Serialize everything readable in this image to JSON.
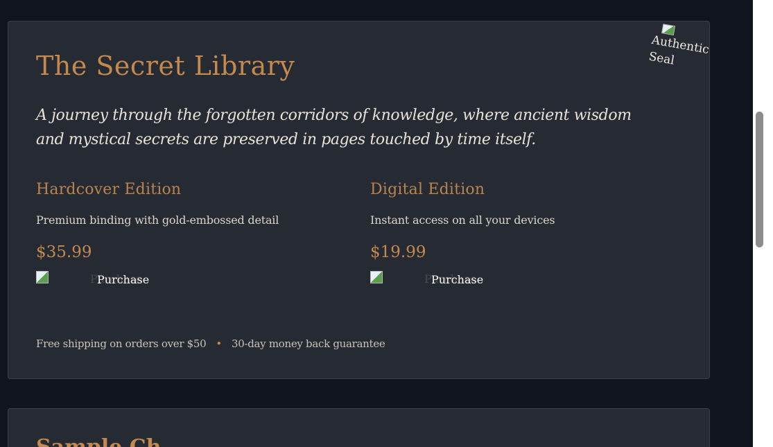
{
  "book": {
    "title": "The Secret Library",
    "subtitle": "A journey through the forgotten corridors of knowledge, where ancient wisdom and mystical secrets are preserved in pages touched by time itself.",
    "seal_alt": "Authentic Seal"
  },
  "editions": [
    {
      "name": "Hardcover Edition",
      "description": "Premium binding with gold-embossed detail",
      "price": "$35.99",
      "button_label": "Purchase"
    },
    {
      "name": "Digital Edition",
      "description": "Instant access on all your devices",
      "price": "$19.99",
      "button_label": "Purchase"
    }
  ],
  "footer": {
    "shipping": "Free shipping on orders over $50",
    "separator": "•",
    "guarantee": "30-day money back guarantee"
  },
  "next_section": {
    "title": "Sample Ch"
  },
  "colors": {
    "background": "#0f141d",
    "card": "#262a33",
    "accent_gold": "#c4894f",
    "text_light": "#e8e3d8"
  }
}
